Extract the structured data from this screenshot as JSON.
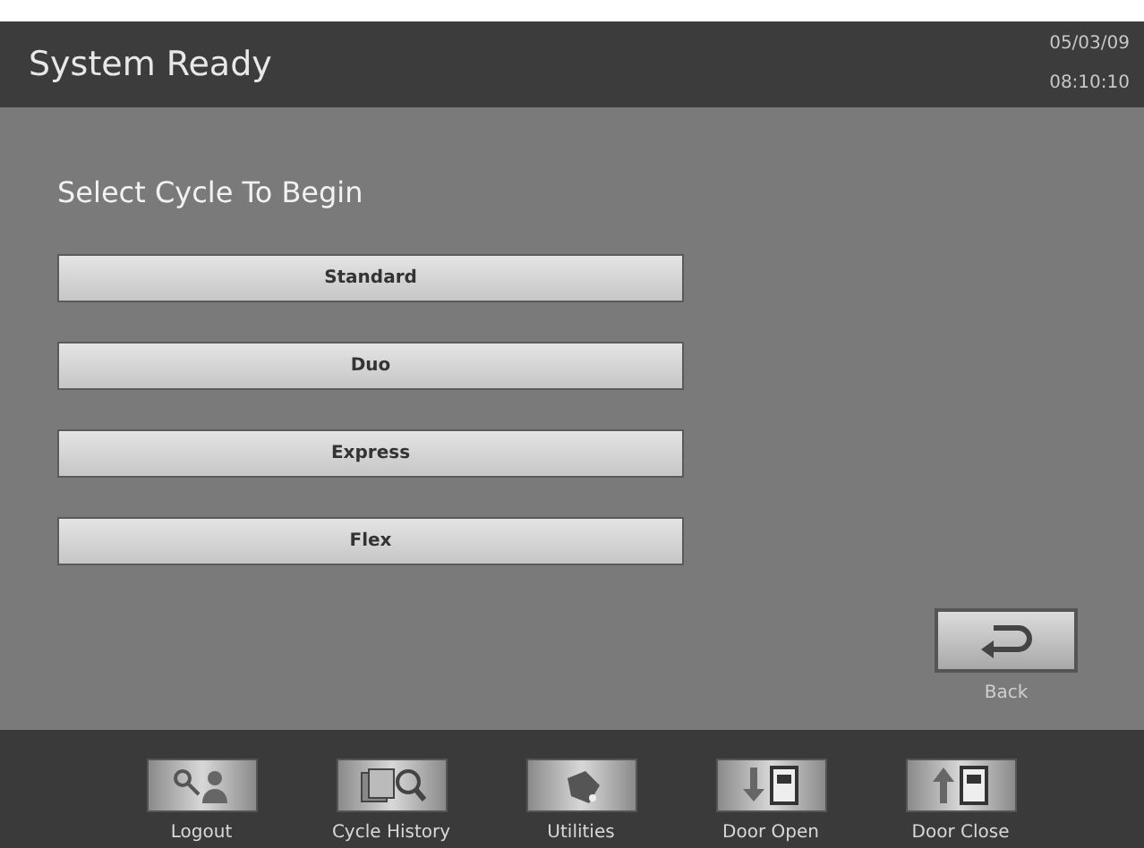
{
  "header": {
    "title": "System Ready",
    "date": "05/03/09",
    "time": "08:10:10"
  },
  "prompt": "Select Cycle To Begin",
  "cycles": [
    "Standard",
    "Duo",
    "Express",
    "Flex"
  ],
  "back": {
    "label": "Back"
  },
  "toolbar": [
    {
      "kind": "logout",
      "label": "Logout"
    },
    {
      "kind": "history",
      "label": "Cycle History"
    },
    {
      "kind": "utilities",
      "label": "Utilities"
    },
    {
      "kind": "door-open",
      "label": "Door Open"
    },
    {
      "kind": "door-close",
      "label": "Door Close"
    }
  ]
}
